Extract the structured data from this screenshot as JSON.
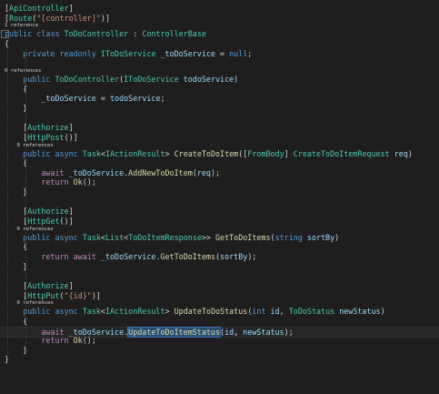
{
  "code_lines": [
    {
      "kind": "code",
      "tokens": [
        [
          "[",
          "p"
        ],
        [
          "ApiController",
          "at"
        ],
        [
          "]",
          "p"
        ]
      ]
    },
    {
      "kind": "code",
      "tokens": [
        [
          "[",
          "p"
        ],
        [
          "Route",
          "at"
        ],
        [
          "(",
          "p"
        ],
        [
          "\"[controller]\"",
          "str"
        ],
        [
          ")]",
          "p"
        ]
      ]
    },
    {
      "kind": "lens",
      "tokens": [
        [
          "1 reference",
          "p"
        ]
      ]
    },
    {
      "kind": "code",
      "tokens": [
        [
          "public",
          "kw"
        ],
        [
          " ",
          "p"
        ],
        [
          "class",
          "kw"
        ],
        [
          " ",
          "p"
        ],
        [
          "ToDoController",
          "ty"
        ],
        [
          " : ",
          "p"
        ],
        [
          "ControllerBase",
          "ty"
        ]
      ]
    },
    {
      "kind": "code",
      "tokens": [
        [
          "{",
          "p"
        ]
      ]
    },
    {
      "kind": "code",
      "tokens": [
        [
          "    ",
          "p"
        ],
        [
          "private",
          "kw"
        ],
        [
          " ",
          "p"
        ],
        [
          "readonly",
          "kw"
        ],
        [
          " ",
          "p"
        ],
        [
          "IToDoService",
          "ty"
        ],
        [
          " ",
          "p"
        ],
        [
          "_toDoService",
          "fld"
        ],
        [
          " = ",
          "p"
        ],
        [
          "null",
          "kw"
        ],
        [
          ";",
          "p"
        ]
      ]
    },
    {
      "kind": "blank",
      "tokens": []
    },
    {
      "kind": "lens",
      "tokens": [
        [
          "0 references",
          "p"
        ]
      ]
    },
    {
      "kind": "code",
      "tokens": [
        [
          "    ",
          "p"
        ],
        [
          "public",
          "kw"
        ],
        [
          " ",
          "p"
        ],
        [
          "ToDoController",
          "ty"
        ],
        [
          "(",
          "p"
        ],
        [
          "IToDoService",
          "ty"
        ],
        [
          " ",
          "p"
        ],
        [
          "todoService",
          "pm"
        ],
        [
          ")",
          "p"
        ]
      ]
    },
    {
      "kind": "code",
      "tokens": [
        [
          "    {",
          "p"
        ]
      ]
    },
    {
      "kind": "code",
      "tokens": [
        [
          "        ",
          "p"
        ],
        [
          "_toDoService",
          "fld"
        ],
        [
          " = ",
          "p"
        ],
        [
          "todoService",
          "pm"
        ],
        [
          ";",
          "p"
        ]
      ]
    },
    {
      "kind": "code",
      "tokens": [
        [
          "    }",
          "p"
        ]
      ]
    },
    {
      "kind": "blank",
      "tokens": []
    },
    {
      "kind": "code",
      "tokens": [
        [
          "    [",
          "p"
        ],
        [
          "Authorize",
          "at"
        ],
        [
          "]",
          "p"
        ]
      ]
    },
    {
      "kind": "code",
      "tokens": [
        [
          "    [",
          "p"
        ],
        [
          "HttpPost",
          "at"
        ],
        [
          "()]",
          "p"
        ]
      ]
    },
    {
      "kind": "lens",
      "tokens": [
        [
          "    0 references",
          "p"
        ]
      ]
    },
    {
      "kind": "code",
      "tokens": [
        [
          "    ",
          "p"
        ],
        [
          "public",
          "kw"
        ],
        [
          " ",
          "p"
        ],
        [
          "async",
          "kw"
        ],
        [
          " ",
          "p"
        ],
        [
          "Task",
          "ty"
        ],
        [
          "<",
          "p"
        ],
        [
          "IActionResult",
          "ty"
        ],
        [
          "> ",
          "p"
        ],
        [
          "CreateToDoItem",
          "fn"
        ],
        [
          "([",
          "p"
        ],
        [
          "FromBody",
          "at"
        ],
        [
          "] ",
          "p"
        ],
        [
          "CreateToDoItemRequest",
          "ty"
        ],
        [
          " ",
          "p"
        ],
        [
          "req",
          "pm"
        ],
        [
          ")",
          "p"
        ]
      ]
    },
    {
      "kind": "code",
      "tokens": [
        [
          "    {",
          "p"
        ]
      ]
    },
    {
      "kind": "code",
      "tokens": [
        [
          "        ",
          "p"
        ],
        [
          "await",
          "ctl"
        ],
        [
          " ",
          "p"
        ],
        [
          "_toDoService",
          "fld"
        ],
        [
          ".",
          "p"
        ],
        [
          "AddNewToDoItem",
          "fn"
        ],
        [
          "(",
          "p"
        ],
        [
          "req",
          "pm"
        ],
        [
          ");",
          "p"
        ]
      ]
    },
    {
      "kind": "code",
      "tokens": [
        [
          "        ",
          "p"
        ],
        [
          "return",
          "ctl"
        ],
        [
          " ",
          "p"
        ],
        [
          "Ok",
          "fn"
        ],
        [
          "();",
          "p"
        ]
      ]
    },
    {
      "kind": "code",
      "tokens": [
        [
          "    }",
          "p"
        ]
      ]
    },
    {
      "kind": "blank",
      "tokens": []
    },
    {
      "kind": "code",
      "tokens": [
        [
          "    [",
          "p"
        ],
        [
          "Authorize",
          "at"
        ],
        [
          "]",
          "p"
        ]
      ]
    },
    {
      "kind": "code",
      "tokens": [
        [
          "    [",
          "p"
        ],
        [
          "HttpGet",
          "at"
        ],
        [
          "()]",
          "p"
        ]
      ]
    },
    {
      "kind": "lens",
      "tokens": [
        [
          "    0 references",
          "p"
        ]
      ]
    },
    {
      "kind": "code",
      "tokens": [
        [
          "    ",
          "p"
        ],
        [
          "public",
          "kw"
        ],
        [
          " ",
          "p"
        ],
        [
          "async",
          "kw"
        ],
        [
          " ",
          "p"
        ],
        [
          "Task",
          "ty"
        ],
        [
          "<",
          "p"
        ],
        [
          "List",
          "ty"
        ],
        [
          "<",
          "p"
        ],
        [
          "ToDoItemResponse",
          "ty"
        ],
        [
          ">> ",
          "p"
        ],
        [
          "GetToDoItems",
          "fn"
        ],
        [
          "(",
          "p"
        ],
        [
          "string",
          "kw"
        ],
        [
          " ",
          "p"
        ],
        [
          "sortBy",
          "pm"
        ],
        [
          ")",
          "p"
        ]
      ]
    },
    {
      "kind": "code",
      "tokens": [
        [
          "    {",
          "p"
        ]
      ]
    },
    {
      "kind": "code",
      "tokens": [
        [
          "        ",
          "p"
        ],
        [
          "return",
          "ctl"
        ],
        [
          " ",
          "p"
        ],
        [
          "await",
          "ctl"
        ],
        [
          " ",
          "p"
        ],
        [
          "_toDoService",
          "fld"
        ],
        [
          ".",
          "p"
        ],
        [
          "GetToDoItems",
          "fn"
        ],
        [
          "(",
          "p"
        ],
        [
          "sortBy",
          "pm"
        ],
        [
          ");",
          "p"
        ]
      ]
    },
    {
      "kind": "code",
      "tokens": [
        [
          "    }",
          "p"
        ]
      ]
    },
    {
      "kind": "blank",
      "tokens": []
    },
    {
      "kind": "code",
      "tokens": [
        [
          "    [",
          "p"
        ],
        [
          "Authorize",
          "at"
        ],
        [
          "]",
          "p"
        ]
      ]
    },
    {
      "kind": "code",
      "tokens": [
        [
          "    [",
          "p"
        ],
        [
          "HttpPut",
          "at"
        ],
        [
          "(",
          "p"
        ],
        [
          "\"{id}\"",
          "str"
        ],
        [
          ")]",
          "p"
        ]
      ]
    },
    {
      "kind": "lens",
      "tokens": [
        [
          "    0 references",
          "p"
        ]
      ]
    },
    {
      "kind": "code",
      "tokens": [
        [
          "    ",
          "p"
        ],
        [
          "public",
          "kw"
        ],
        [
          " ",
          "p"
        ],
        [
          "async",
          "kw"
        ],
        [
          " ",
          "p"
        ],
        [
          "Task",
          "ty"
        ],
        [
          "<",
          "p"
        ],
        [
          "IActionResult",
          "ty"
        ],
        [
          "> ",
          "p"
        ],
        [
          "UpdateToDoStatus",
          "fn"
        ],
        [
          "(",
          "p"
        ],
        [
          "int",
          "kw"
        ],
        [
          " ",
          "p"
        ],
        [
          "id",
          "pm"
        ],
        [
          ", ",
          "p"
        ],
        [
          "ToDoStatus",
          "ty"
        ],
        [
          " ",
          "p"
        ],
        [
          "newStatus",
          "pm"
        ],
        [
          ")",
          "p"
        ]
      ]
    },
    {
      "kind": "code",
      "tokens": [
        [
          "    {",
          "p"
        ]
      ]
    },
    {
      "kind": "current",
      "tokens": [
        [
          "        ",
          "p"
        ],
        [
          "await",
          "ctl"
        ],
        [
          " ",
          "p"
        ],
        [
          "_toDoService",
          "fld"
        ],
        [
          ".",
          "p"
        ],
        [
          "UpdateToDoItemStatus",
          "fn-hl"
        ],
        [
          "(",
          "p"
        ],
        [
          "id",
          "pm"
        ],
        [
          ", ",
          "p"
        ],
        [
          "newStatus",
          "pm"
        ],
        [
          ");",
          "p"
        ]
      ]
    },
    {
      "kind": "code",
      "tokens": [
        [
          "        ",
          "p"
        ],
        [
          "return",
          "ctl"
        ],
        [
          " ",
          "p"
        ],
        [
          "Ok",
          "fn"
        ],
        [
          "();",
          "p"
        ]
      ]
    },
    {
      "kind": "code",
      "tokens": [
        [
          "    }",
          "p"
        ]
      ]
    },
    {
      "kind": "code",
      "tokens": [
        [
          "}",
          "p"
        ]
      ]
    }
  ],
  "colors": {
    "background": "#1e1e1e",
    "keyword": "#569cd6",
    "type": "#4ec9b0",
    "method": "#dcdcaa",
    "parameter": "#9cdcfe",
    "string": "#ce9178",
    "control": "#c586c0",
    "codelens": "#999999"
  }
}
